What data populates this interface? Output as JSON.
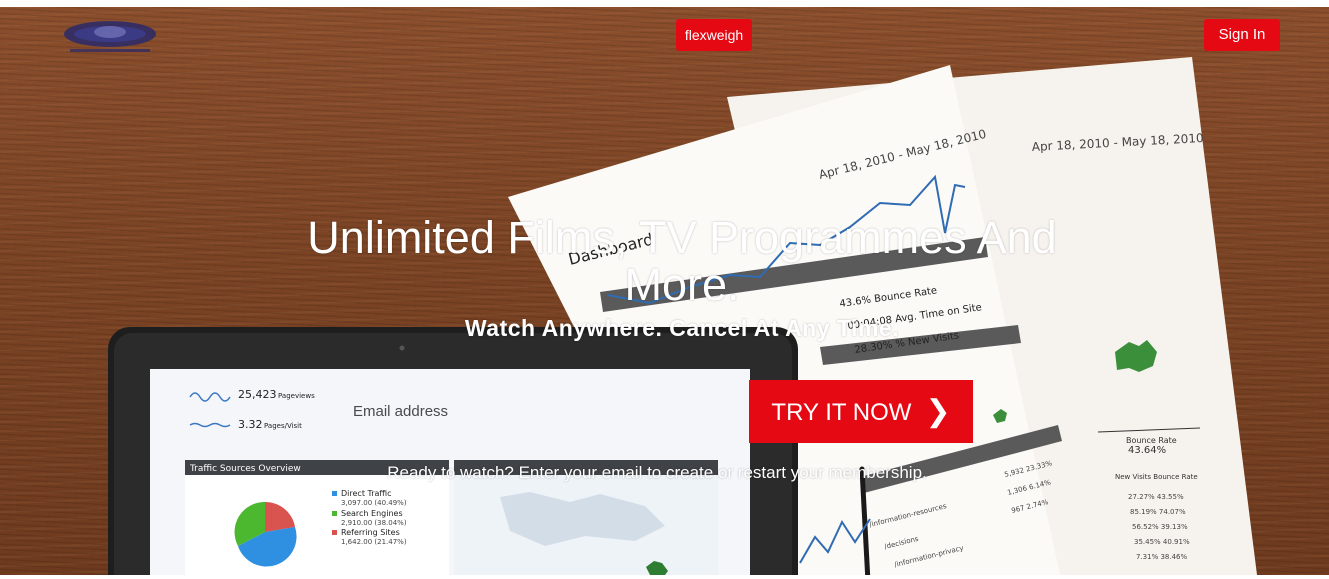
{
  "header": {
    "brand_button_label": "flexweigh",
    "sign_in_label": "Sign In",
    "logo_icon": "logo-icon"
  },
  "hero": {
    "title": "Unlimited Films, TV Programmes And More.",
    "subtitle": "Watch Anywhere. Cancel At Any Time.",
    "background_image": "desk with tablet analytics dashboard and printed reports"
  },
  "signup": {
    "email_placeholder": "Email address",
    "cta_label": "TRY IT NOW",
    "cta_icon": "chevron-right-icon",
    "ready_text": "Ready to watch? Enter your email to create or restart your membership."
  },
  "colors": {
    "accent": "#e50914",
    "text": "#ffffff",
    "wood": "#7a4324"
  }
}
